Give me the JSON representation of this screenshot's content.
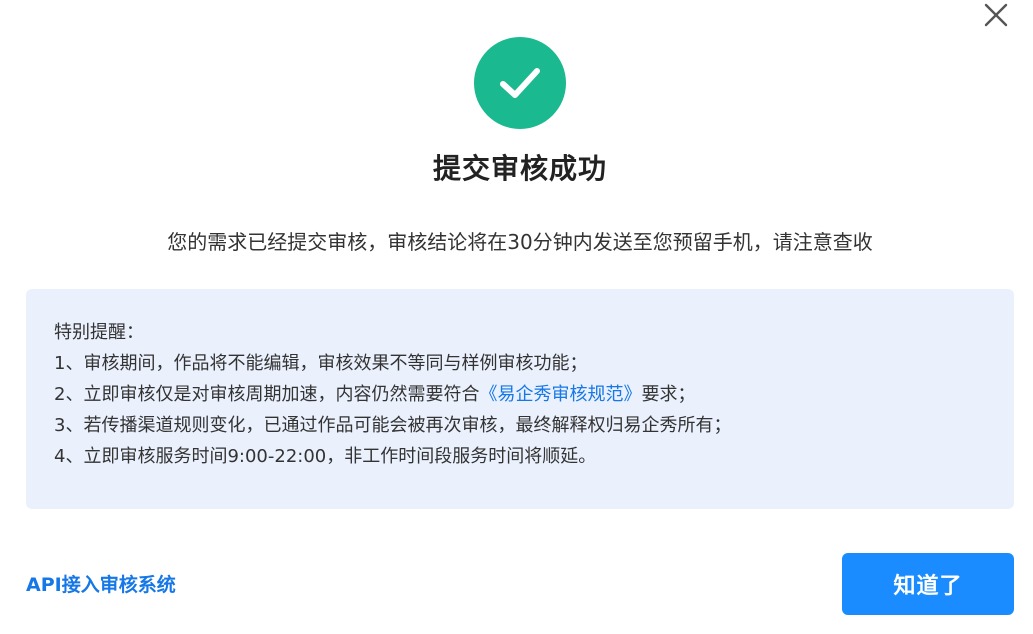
{
  "colors": {
    "success_green": "#1bb98f",
    "primary_blue": "#1a8cff",
    "link_blue": "#1677e6",
    "notice_bg": "#eaf1fd",
    "close_gray": "#555555"
  },
  "dialog": {
    "close_icon": "close-icon",
    "success_icon": "check-circle-icon",
    "title": "提交审核成功",
    "subtitle": "您的需求已经提交审核，审核结论将在30分钟内发送至您预留手机，请注意查收"
  },
  "notice": {
    "heading": "特别提醒：",
    "item1": "1、审核期间，作品将不能编辑，审核效果不等同与样例审核功能；",
    "item2_prefix": "2、立即审核仅是对审核周期加速，内容仍然需要符合",
    "item2_link": "《易企秀审核规范》",
    "item2_suffix": "要求；",
    "item3": "3、若传播渠道规则变化，已通过作品可能会被再次审核，最终解释权归易企秀所有；",
    "item4": "4、立即审核服务时间9:00-22:00，非工作时间段服务时间将顺延。"
  },
  "footer": {
    "api_link_label": "API接入审核系统",
    "ok_button_label": "知道了"
  }
}
